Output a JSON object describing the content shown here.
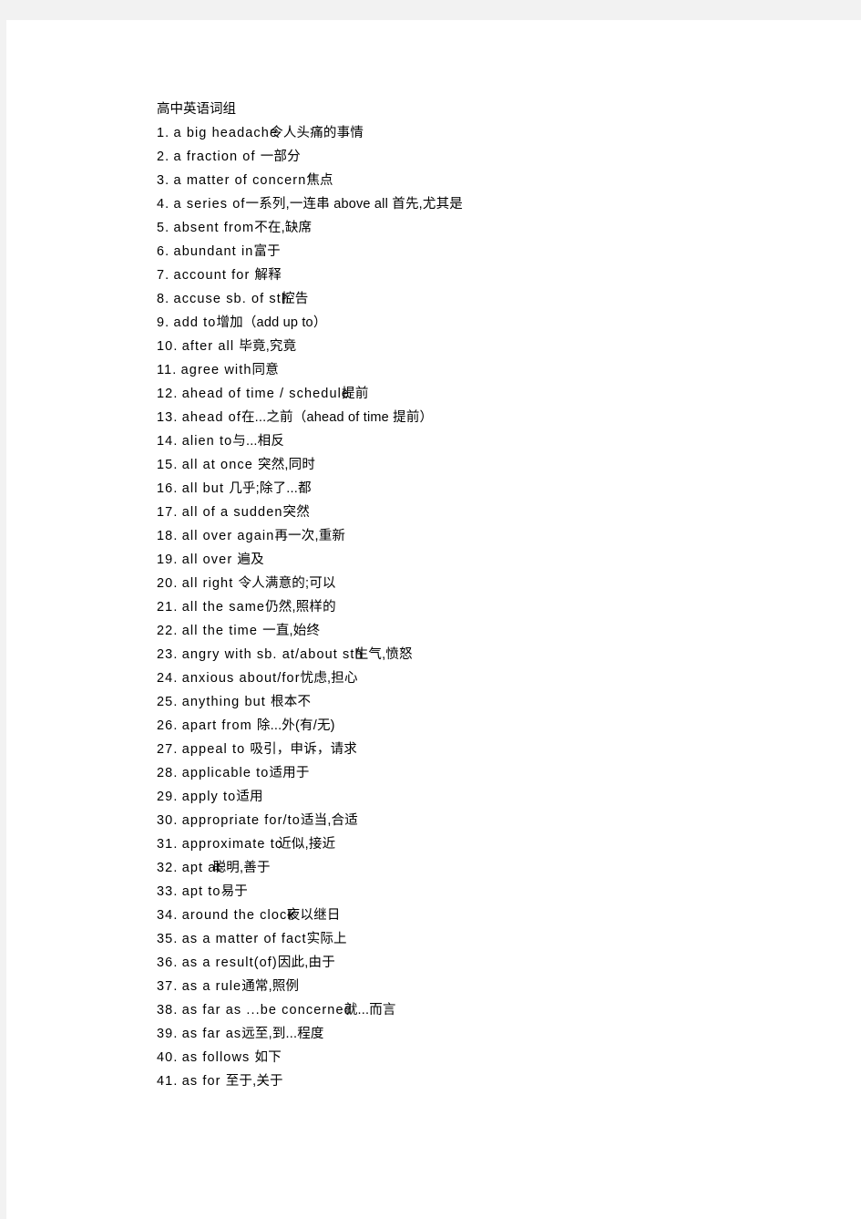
{
  "document": {
    "title": "高中英语词组",
    "entries": [
      {
        "num": "1.",
        "en": "a big headache",
        "zh": "令人头痛的事情",
        "overlap": "ov"
      },
      {
        "num": "2.",
        "en": "a fraction of ",
        "zh": "一部分",
        "overlap": ""
      },
      {
        "num": "3.",
        "en": "a matter of concern",
        "zh": "焦点",
        "overlap": ""
      },
      {
        "num": "4.",
        "en": "a series of",
        "zh": "一系列,一连串 above all 首先,尤其是",
        "overlap": ""
      },
      {
        "num": "5.",
        "en": "absent from",
        "zh": "不在,缺席",
        "overlap": ""
      },
      {
        "num": "6.",
        "en": "abundant in",
        "zh": "富于",
        "overlap": ""
      },
      {
        "num": "7.",
        "en": "account for ",
        "zh": "解释",
        "overlap": ""
      },
      {
        "num": "8.",
        "en": "accuse sb. of sth",
        "zh": "控告",
        "overlap": "ov"
      },
      {
        "num": "9.",
        "en": "add to",
        "zh": "增加（add up to）",
        "overlap": ""
      },
      {
        "num": "10.",
        "en": "after all ",
        "zh": "毕竟,究竟",
        "overlap": ""
      },
      {
        "num": "11.",
        "en": "agree with",
        "zh": "同意",
        "overlap": ""
      },
      {
        "num": "12.",
        "en": "ahead of time / schedule",
        "zh": "提前",
        "overlap": "ov"
      },
      {
        "num": "13.",
        "en": "ahead of",
        "zh": "在...之前（ahead of time 提前）",
        "overlap": ""
      },
      {
        "num": "14.",
        "en": "alien to",
        "zh": "与...相反",
        "overlap": ""
      },
      {
        "num": "15.",
        "en": "all at once ",
        "zh": "突然,同时",
        "overlap": ""
      },
      {
        "num": "16.",
        "en": "all but ",
        "zh": "几乎;除了...都",
        "overlap": ""
      },
      {
        "num": "17.",
        "en": "all of a sudden",
        "zh": "突然",
        "overlap": ""
      },
      {
        "num": "18.",
        "en": "all over again",
        "zh": "再一次,重新",
        "overlap": ""
      },
      {
        "num": "19.",
        "en": "all over ",
        "zh": "遍及",
        "overlap": ""
      },
      {
        "num": "20.",
        "en": "all right ",
        "zh": "令人满意的;可以",
        "overlap": ""
      },
      {
        "num": "21.",
        "en": "all the same",
        "zh": "仍然,照样的",
        "overlap": ""
      },
      {
        "num": "22.",
        "en": "all the time ",
        "zh": "一直,始终",
        "overlap": ""
      },
      {
        "num": "23.",
        "en": "angry with sb. at/about sth",
        "zh": "生气,愤怒",
        "overlap": "ov"
      },
      {
        "num": "24.",
        "en": "anxious about/for",
        "zh": "忧虑,担心",
        "overlap": ""
      },
      {
        "num": "25.",
        "en": "anything but ",
        "zh": "根本不",
        "overlap": ""
      },
      {
        "num": "26.",
        "en": "apart from ",
        "zh": "除...外(有/无)",
        "overlap": ""
      },
      {
        "num": "27.",
        "en": "appeal to ",
        "zh": "吸引，申诉，请求",
        "overlap": ""
      },
      {
        "num": "28.",
        "en": "applicable to",
        "zh": "适用于",
        "overlap": ""
      },
      {
        "num": "29.",
        "en": "apply to",
        "zh": "适用",
        "overlap": ""
      },
      {
        "num": "30.",
        "en": "appropriate for/to",
        "zh": "适当,合适",
        "overlap": ""
      },
      {
        "num": "31.",
        "en": "approximate to",
        "zh": "近似,接近",
        "overlap": "ov2"
      },
      {
        "num": "32.",
        "en": "apt at",
        "zh": "聪明,善于",
        "overlap": "ov"
      },
      {
        "num": "33.",
        "en": "apt to",
        "zh": "易于",
        "overlap": ""
      },
      {
        "num": "34.",
        "en": "around the clock",
        "zh": "夜以继日",
        "overlap": "ov"
      },
      {
        "num": "35.",
        "en": "as a matter of fact",
        "zh": "实际上",
        "overlap": ""
      },
      {
        "num": "36.",
        "en": "as a result(of)",
        "zh": "因此,由于",
        "overlap": ""
      },
      {
        "num": "37.",
        "en": "as a rule",
        "zh": "通常,照例",
        "overlap": ""
      },
      {
        "num": "38.",
        "en": "as far as ...be concerned",
        "zh": "就...而言",
        "overlap": "ov"
      },
      {
        "num": "39.",
        "en": "as far as",
        "zh": "远至,到...程度",
        "overlap": ""
      },
      {
        "num": "40.",
        "en": "as follows ",
        "zh": "如下",
        "overlap": ""
      },
      {
        "num": "41.",
        "en": "as for ",
        "zh": "至于,关于",
        "overlap": ""
      }
    ]
  },
  "colors": {
    "page_background": "#ffffff",
    "canvas_background": "#f2f2f2",
    "text": "#000000"
  }
}
